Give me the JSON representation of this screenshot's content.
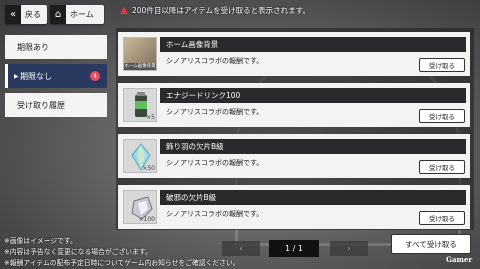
{
  "header": {
    "back_label": "戻る",
    "home_label": "ホーム",
    "notice": "200件目以降はアイテムを受け取ると表示されます。"
  },
  "tabs": [
    {
      "label": "期限あり",
      "active": false
    },
    {
      "label": "期限なし",
      "active": true,
      "badge": "4"
    },
    {
      "label": "受け取り履歴",
      "active": false
    }
  ],
  "items": [
    {
      "title": "ホーム画像背景",
      "description": "シノアリスコラボの報酬です。",
      "claim_label": "受け取る",
      "thumb_caption": "ホーム画像背景",
      "quantity": ""
    },
    {
      "title": "エナジードリンク100",
      "description": "シノアリスコラボの報酬です。",
      "claim_label": "受け取る",
      "thumb_caption": "",
      "quantity": "×5"
    },
    {
      "title": "飾り羽の欠片B級",
      "description": "シノアリスコラボの報酬です。",
      "claim_label": "受け取る",
      "thumb_caption": "",
      "quantity": "×50"
    },
    {
      "title": "破邪の欠片B級",
      "description": "シノアリスコラボの報酬です。",
      "claim_label": "受け取る",
      "thumb_caption": "",
      "quantity": "×100"
    }
  ],
  "footer": {
    "notes": [
      "※画像はイメージです。",
      "※内容は予告なく変更になる場合がございます。",
      "※報酬アイテムの配布予定日時についてゲーム内お知らせをご確認ください。"
    ],
    "page_indicator": "1 / 1",
    "claim_all_label": "すべて受け取る",
    "watermark": "Gamer"
  }
}
